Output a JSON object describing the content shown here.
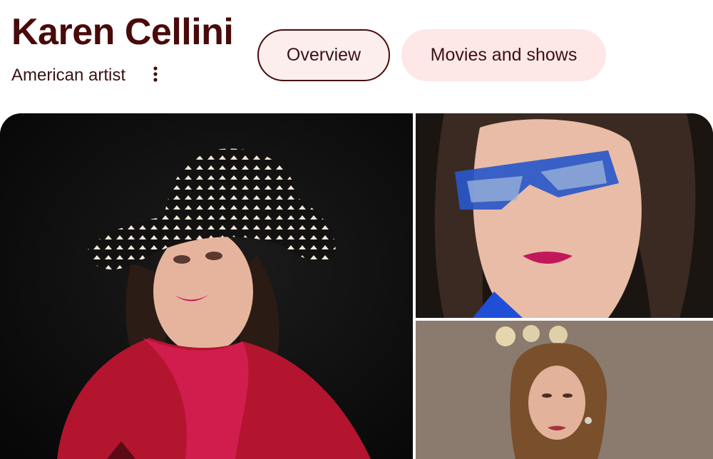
{
  "entity": {
    "name": "Karen Cellini",
    "description": "American artist"
  },
  "tabs": [
    {
      "label": "Overview",
      "selected": true
    },
    {
      "label": "Movies and shows",
      "selected": false
    }
  ],
  "icons": {
    "more": "more-vertical-icon"
  },
  "colors": {
    "title": "#4a0a0a",
    "chip_border": "#4a0a0a",
    "chip_background": "#fde7e7",
    "text": "#3b1212"
  },
  "gallery": [
    {
      "name": "photo-woman-polka-dot-hat"
    },
    {
      "name": "photo-woman-blue-glasses"
    },
    {
      "name": "photo-woman-vintage-still"
    }
  ]
}
